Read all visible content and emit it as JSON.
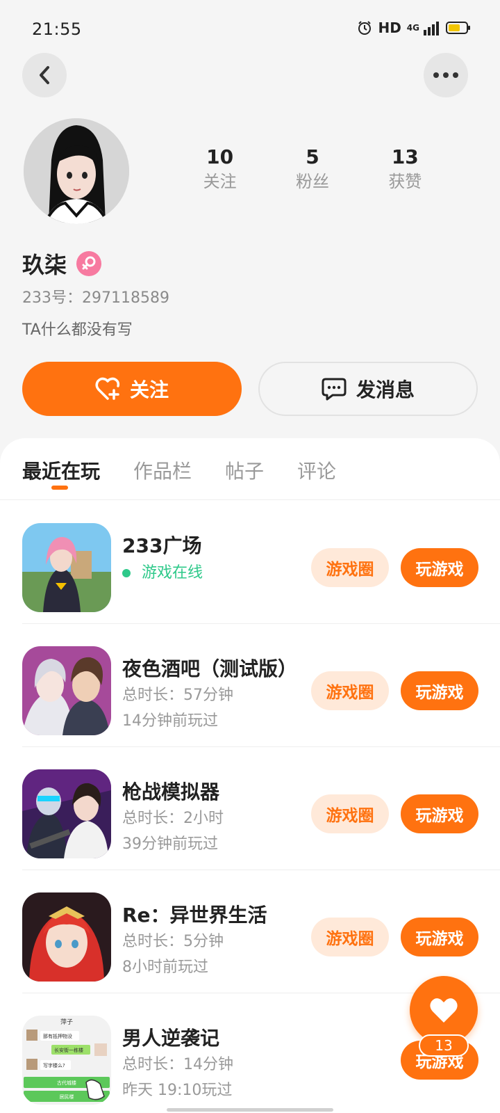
{
  "status_bar": {
    "time": "21:55",
    "hd": "HD",
    "network": "4G"
  },
  "profile": {
    "name": "玖柒",
    "id_label": "233号：297118589",
    "bio": "TA什么都没有写",
    "stats": [
      {
        "value": "10",
        "label": "关注"
      },
      {
        "value": "5",
        "label": "粉丝"
      },
      {
        "value": "13",
        "label": "获赞"
      }
    ],
    "follow_label": "关注",
    "message_label": "发消息"
  },
  "tabs": [
    {
      "label": "最近在玩",
      "active": true
    },
    {
      "label": "作品栏",
      "active": false
    },
    {
      "label": "帖子",
      "active": false
    },
    {
      "label": "评论",
      "active": false
    }
  ],
  "games": [
    {
      "title": "233广场",
      "status": "游戏在线",
      "online": true,
      "circle_label": "游戏圈",
      "play_label": "玩游戏"
    },
    {
      "title": "夜色酒吧（测试版）",
      "duration": "总时长：57分钟",
      "last_played": "14分钟前玩过",
      "circle_label": "游戏圈",
      "play_label": "玩游戏"
    },
    {
      "title": "枪战模拟器",
      "duration": "总时长：2小时",
      "last_played": "39分钟前玩过",
      "circle_label": "游戏圈",
      "play_label": "玩游戏"
    },
    {
      "title": "Re：异世界生活",
      "duration": "总时长：5分钟",
      "last_played": "8小时前玩过",
      "circle_label": "游戏圈",
      "play_label": "玩游戏"
    },
    {
      "title": "男人逆袭记",
      "duration": "总时长：14分钟",
      "last_played": "昨天 19:10玩过",
      "play_label": "玩游戏"
    }
  ],
  "icon5_text": {
    "header": "萍子",
    "b1": "那有抵押物没",
    "b2": "长安街一栋楼",
    "b3": "写字楼么?",
    "b4": "古代城楼",
    "b5": "居民楼"
  },
  "fab": {
    "count": "13"
  },
  "colors": {
    "accent": "#ff7210",
    "online": "#2ec98a",
    "gender": "#f77aa0"
  }
}
